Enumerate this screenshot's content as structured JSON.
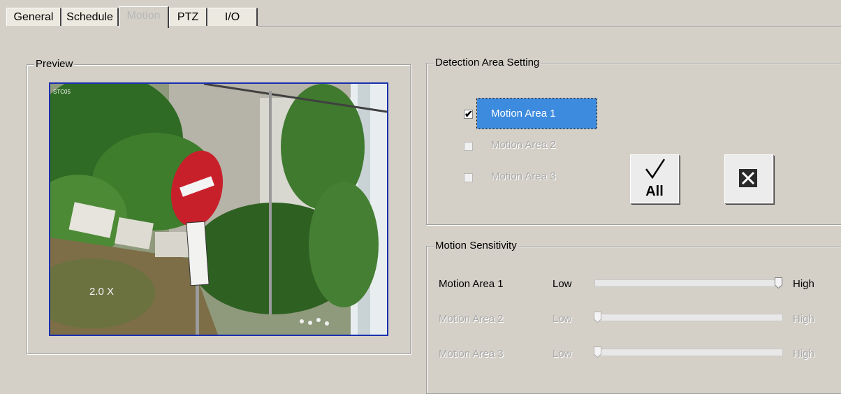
{
  "tabs": [
    {
      "label": "General"
    },
    {
      "label": "Schedule"
    },
    {
      "label": "Motion"
    },
    {
      "label": "PTZ"
    },
    {
      "label": "I/O"
    }
  ],
  "preview": {
    "legend": "Preview",
    "overlay_top": "STC05",
    "overlay_zoom": "2.0 X"
  },
  "detection": {
    "legend": "Detection Area Setting",
    "areas": [
      {
        "label": "Motion Area 1",
        "checked": true
      },
      {
        "label": "Motion Area 2",
        "checked": false
      },
      {
        "label": "Motion Area 3",
        "checked": false
      }
    ],
    "all_button": "All",
    "clear_button": "clear-x-icon"
  },
  "sensitivity": {
    "legend": "Motion Sensitivity",
    "low_label": "Low",
    "high_label": "High",
    "rows": [
      {
        "label": "Motion Area 1",
        "level": 1.0,
        "enabled": true
      },
      {
        "label": "Motion Area 2",
        "level": 0.0,
        "enabled": false
      },
      {
        "label": "Motion Area 3",
        "level": 0.0,
        "enabled": false
      }
    ]
  }
}
